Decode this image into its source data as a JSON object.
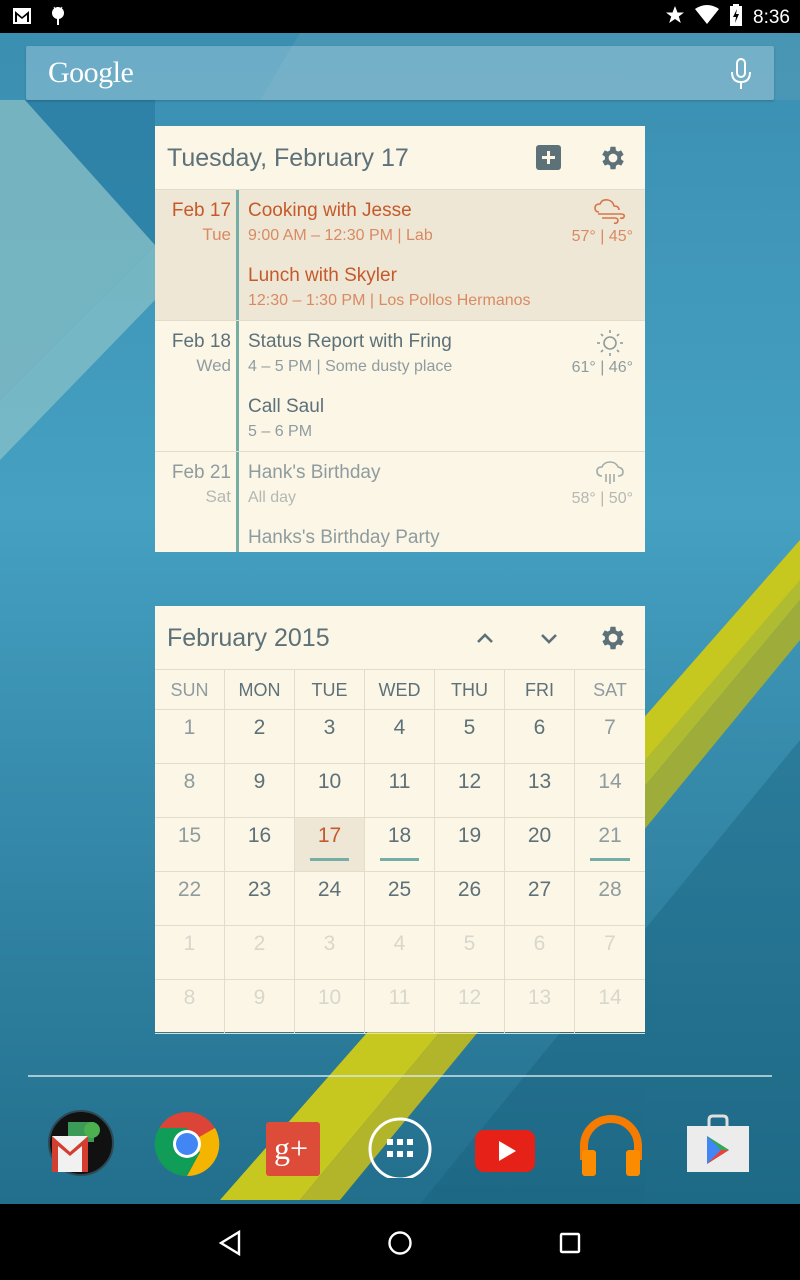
{
  "status_bar": {
    "notifications": [
      "gmail-icon",
      "android-debug-icon"
    ],
    "indicators": [
      "star-icon",
      "wifi-icon",
      "battery-charging-icon"
    ],
    "time": "8:36"
  },
  "search": {
    "logo": "Google",
    "mic_icon": "mic-icon"
  },
  "agenda": {
    "title": "Tuesday, February 17",
    "add_icon": "add-event-icon",
    "settings_icon": "gear-icon",
    "days": [
      {
        "date": "Feb 17",
        "dow": "Tue",
        "style": "orange",
        "weather": {
          "icon": "wind-cloud-icon",
          "high": "57°",
          "low": "45°",
          "temps": "57° | 45°"
        },
        "events": [
          {
            "title": "Cooking with Jesse",
            "sub": "9:00 AM – 12:30 PM  |  Lab"
          },
          {
            "title": "Lunch with Skyler",
            "sub": "12:30 – 1:30 PM  |  Los Pollos Hermanos"
          }
        ]
      },
      {
        "date": "Feb 18",
        "dow": "Wed",
        "style": "slate",
        "weather": {
          "icon": "sun-icon",
          "high": "61°",
          "low": "46°",
          "temps": "61° | 46°"
        },
        "events": [
          {
            "title": "Status Report with Fring",
            "sub": "4 – 5 PM  |  Some dusty place"
          },
          {
            "title": "Call Saul",
            "sub": "5 – 6 PM"
          }
        ]
      },
      {
        "date": "Feb 21",
        "dow": "Sat",
        "style": "muted",
        "weather": {
          "icon": "rain-icon",
          "high": "58°",
          "low": "50°",
          "temps": "58° | 50°"
        },
        "events": [
          {
            "title": "Hank's Birthday",
            "sub": "All day"
          },
          {
            "title": "Hanks's Birthday Party",
            "sub": ""
          }
        ]
      }
    ]
  },
  "month": {
    "title": "February 2015",
    "prev_icon": "chevron-up-icon",
    "next_icon": "chevron-down-icon",
    "settings_icon": "gear-icon",
    "weekdays": [
      "SUN",
      "MON",
      "TUE",
      "WED",
      "THU",
      "FRI",
      "SAT"
    ],
    "weeks": [
      [
        "1",
        "2",
        "3",
        "4",
        "5",
        "6",
        "7"
      ],
      [
        "8",
        "9",
        "10",
        "11",
        "12",
        "13",
        "14"
      ],
      [
        "15",
        "16",
        "17",
        "18",
        "19",
        "20",
        "21"
      ],
      [
        "22",
        "23",
        "24",
        "25",
        "26",
        "27",
        "28"
      ],
      [
        "1",
        "2",
        "3",
        "4",
        "5",
        "6",
        "7"
      ],
      [
        "8",
        "9",
        "10",
        "11",
        "12",
        "13",
        "14"
      ]
    ],
    "today": "17",
    "days_with_events": [
      "17",
      "18",
      "21"
    ],
    "accent_color": "#c45a2b",
    "event_marker_color": "#76ada4"
  },
  "dock": {
    "apps": [
      {
        "name": "Google apps folder",
        "icon": "gmail-folder-icon"
      },
      {
        "name": "Chrome",
        "icon": "chrome-icon"
      },
      {
        "name": "Google+",
        "icon": "google-plus-icon"
      },
      {
        "name": "All apps",
        "icon": "app-drawer-icon"
      },
      {
        "name": "YouTube",
        "icon": "youtube-icon"
      },
      {
        "name": "Play Music",
        "icon": "headphones-icon"
      },
      {
        "name": "Play Store",
        "icon": "play-store-icon"
      }
    ],
    "google_plus_label": "g+"
  },
  "nav_bar": {
    "buttons": [
      "back-icon",
      "home-icon",
      "recents-icon"
    ]
  }
}
